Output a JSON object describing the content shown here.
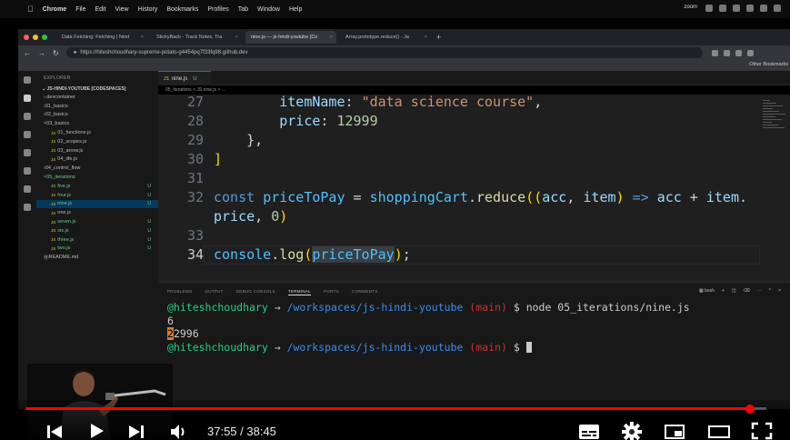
{
  "menubar": {
    "app": "Chrome",
    "items": [
      "File",
      "Edit",
      "View",
      "History",
      "Bookmarks",
      "Profiles",
      "Tab",
      "Window",
      "Help"
    ],
    "zoom": "zoom"
  },
  "browser": {
    "tabs": [
      {
        "title": "Data Fetching: Fetching | Next",
        "active": false
      },
      {
        "title": "StickyBack - Track Notes, Tra",
        "active": false
      },
      {
        "title": "nine.js — js-hindi-youtube [Co",
        "active": true
      },
      {
        "title": "Array.prototype.reduce() - Ja",
        "active": false
      }
    ],
    "url": "https://hiteshchoudhary-supreme-potato-g4454pq7f33fq98.github.dev",
    "bookmarks_other": "Other Bookmarks"
  },
  "vscode": {
    "explorer_header": "EXPLORER",
    "root": "JS-HINDI-YOUTUBE [CODESPACES]",
    "tree": [
      {
        "name": ".devcontainer",
        "type": "folder",
        "depth": 1,
        "badge": ""
      },
      {
        "name": "01_basics",
        "type": "folder",
        "depth": 1,
        "badge": ""
      },
      {
        "name": "02_basics",
        "type": "folder",
        "depth": 1,
        "badge": ""
      },
      {
        "name": "03_basics",
        "type": "folder",
        "depth": 1,
        "badge": "",
        "open": true
      },
      {
        "name": "01_functions.js",
        "type": "js",
        "depth": 2,
        "badge": ""
      },
      {
        "name": "02_scopes.js",
        "type": "js",
        "depth": 2,
        "badge": ""
      },
      {
        "name": "03_arrow.js",
        "type": "js",
        "depth": 2,
        "badge": ""
      },
      {
        "name": "04_iife.js",
        "type": "js",
        "depth": 2,
        "badge": ""
      },
      {
        "name": "04_control_flow",
        "type": "folder",
        "depth": 1,
        "badge": ""
      },
      {
        "name": "05_iterations",
        "type": "folder",
        "depth": 1,
        "badge": "",
        "open": true,
        "green": true
      },
      {
        "name": "five.js",
        "type": "js",
        "depth": 2,
        "badge": "U",
        "green": true
      },
      {
        "name": "four.js",
        "type": "js",
        "depth": 2,
        "badge": "U",
        "green": true
      },
      {
        "name": "nine.js",
        "type": "js",
        "depth": 2,
        "badge": "U",
        "green": true,
        "selected": true
      },
      {
        "name": "one.js",
        "type": "js",
        "depth": 2,
        "badge": ""
      },
      {
        "name": "seven.js",
        "type": "js",
        "depth": 2,
        "badge": "U",
        "green": true
      },
      {
        "name": "six.js",
        "type": "js",
        "depth": 2,
        "badge": "U",
        "green": true
      },
      {
        "name": "three.js",
        "type": "js",
        "depth": 2,
        "badge": "U",
        "green": true
      },
      {
        "name": "two.js",
        "type": "js",
        "depth": 2,
        "badge": "U",
        "green": true
      },
      {
        "name": "README.md",
        "type": "md",
        "depth": 1,
        "badge": ""
      }
    ],
    "editor_tab": {
      "icon": "JS",
      "name": "nine.js",
      "status": "U"
    },
    "breadcrumb": "05_iterations  >  JS nine.js  > ...",
    "code_lines": [
      {
        "n": "27",
        "tokens": [
          {
            "t": "        ",
            "c": ""
          },
          {
            "t": "itemName",
            "c": "prop"
          },
          {
            "t": ": ",
            "c": "pun"
          },
          {
            "t": "\"data science course\"",
            "c": "str"
          },
          {
            "t": ",",
            "c": "pun"
          }
        ]
      },
      {
        "n": "28",
        "tokens": [
          {
            "t": "        ",
            "c": ""
          },
          {
            "t": "price",
            "c": "prop"
          },
          {
            "t": ": ",
            "c": "pun"
          },
          {
            "t": "12999",
            "c": "num"
          }
        ]
      },
      {
        "n": "29",
        "tokens": [
          {
            "t": "    ",
            "c": ""
          },
          {
            "t": "}",
            "c": "pun"
          },
          {
            "t": ",",
            "c": "pun"
          }
        ]
      },
      {
        "n": "30",
        "tokens": [
          {
            "t": "]",
            "c": "brk"
          }
        ]
      },
      {
        "n": "31",
        "tokens": []
      },
      {
        "n": "32",
        "tokens": [
          {
            "t": "const",
            "c": "kw"
          },
          {
            "t": " ",
            "c": ""
          },
          {
            "t": "priceToPay",
            "c": "var"
          },
          {
            "t": " = ",
            "c": "pun"
          },
          {
            "t": "shoppingCart",
            "c": "var"
          },
          {
            "t": ".",
            "c": "pun"
          },
          {
            "t": "reduce",
            "c": "fn"
          },
          {
            "t": "((",
            "c": "brk"
          },
          {
            "t": "acc",
            "c": "prop"
          },
          {
            "t": ", ",
            "c": "pun"
          },
          {
            "t": "item",
            "c": "prop"
          },
          {
            "t": ")",
            "c": "brk"
          },
          {
            "t": " ",
            "c": ""
          },
          {
            "t": "=>",
            "c": "kw"
          },
          {
            "t": " ",
            "c": ""
          },
          {
            "t": "acc",
            "c": "prop"
          },
          {
            "t": " + ",
            "c": "pun"
          },
          {
            "t": "item",
            "c": "prop"
          },
          {
            "t": ".",
            "c": "pun"
          }
        ]
      },
      {
        "n": "",
        "tokens": [
          {
            "t": "price",
            "c": "prop"
          },
          {
            "t": ", ",
            "c": "pun"
          },
          {
            "t": "0",
            "c": "num"
          },
          {
            "t": ")",
            "c": "brk"
          }
        ]
      },
      {
        "n": "33",
        "tokens": []
      },
      {
        "n": "34",
        "tokens": [
          {
            "t": "console",
            "c": "var"
          },
          {
            "t": ".",
            "c": "pun"
          },
          {
            "t": "log",
            "c": "fn"
          },
          {
            "t": "(",
            "c": "brk"
          },
          {
            "t": "priceToPay",
            "c": "var hl"
          },
          {
            "t": ")",
            "c": "brk"
          },
          {
            "t": ";",
            "c": "pun"
          }
        ],
        "current": true
      }
    ]
  },
  "panel": {
    "tabs": [
      "PROBLEMS",
      "OUTPUT",
      "DEBUG CONSOLE",
      "TERMINAL",
      "PORTS",
      "COMMENTS"
    ],
    "active_tab": "TERMINAL",
    "shell": "bash",
    "terminal": {
      "user": "@hiteshchoudhary",
      "arrow": " → ",
      "path": "/workspaces/js-hindi-youtube",
      "branch": "(main)",
      "command": " $ node 05_iterations/nine.js",
      "output1": "6",
      "output2_first": "2",
      "output2_rest": "2996",
      "prompt_tail": " $ "
    }
  },
  "player": {
    "current_time": "37:55",
    "duration": "38:45",
    "time_display": "37:55 / 38:45",
    "progress_fraction": 0.9785,
    "accent": "#ff0000"
  }
}
